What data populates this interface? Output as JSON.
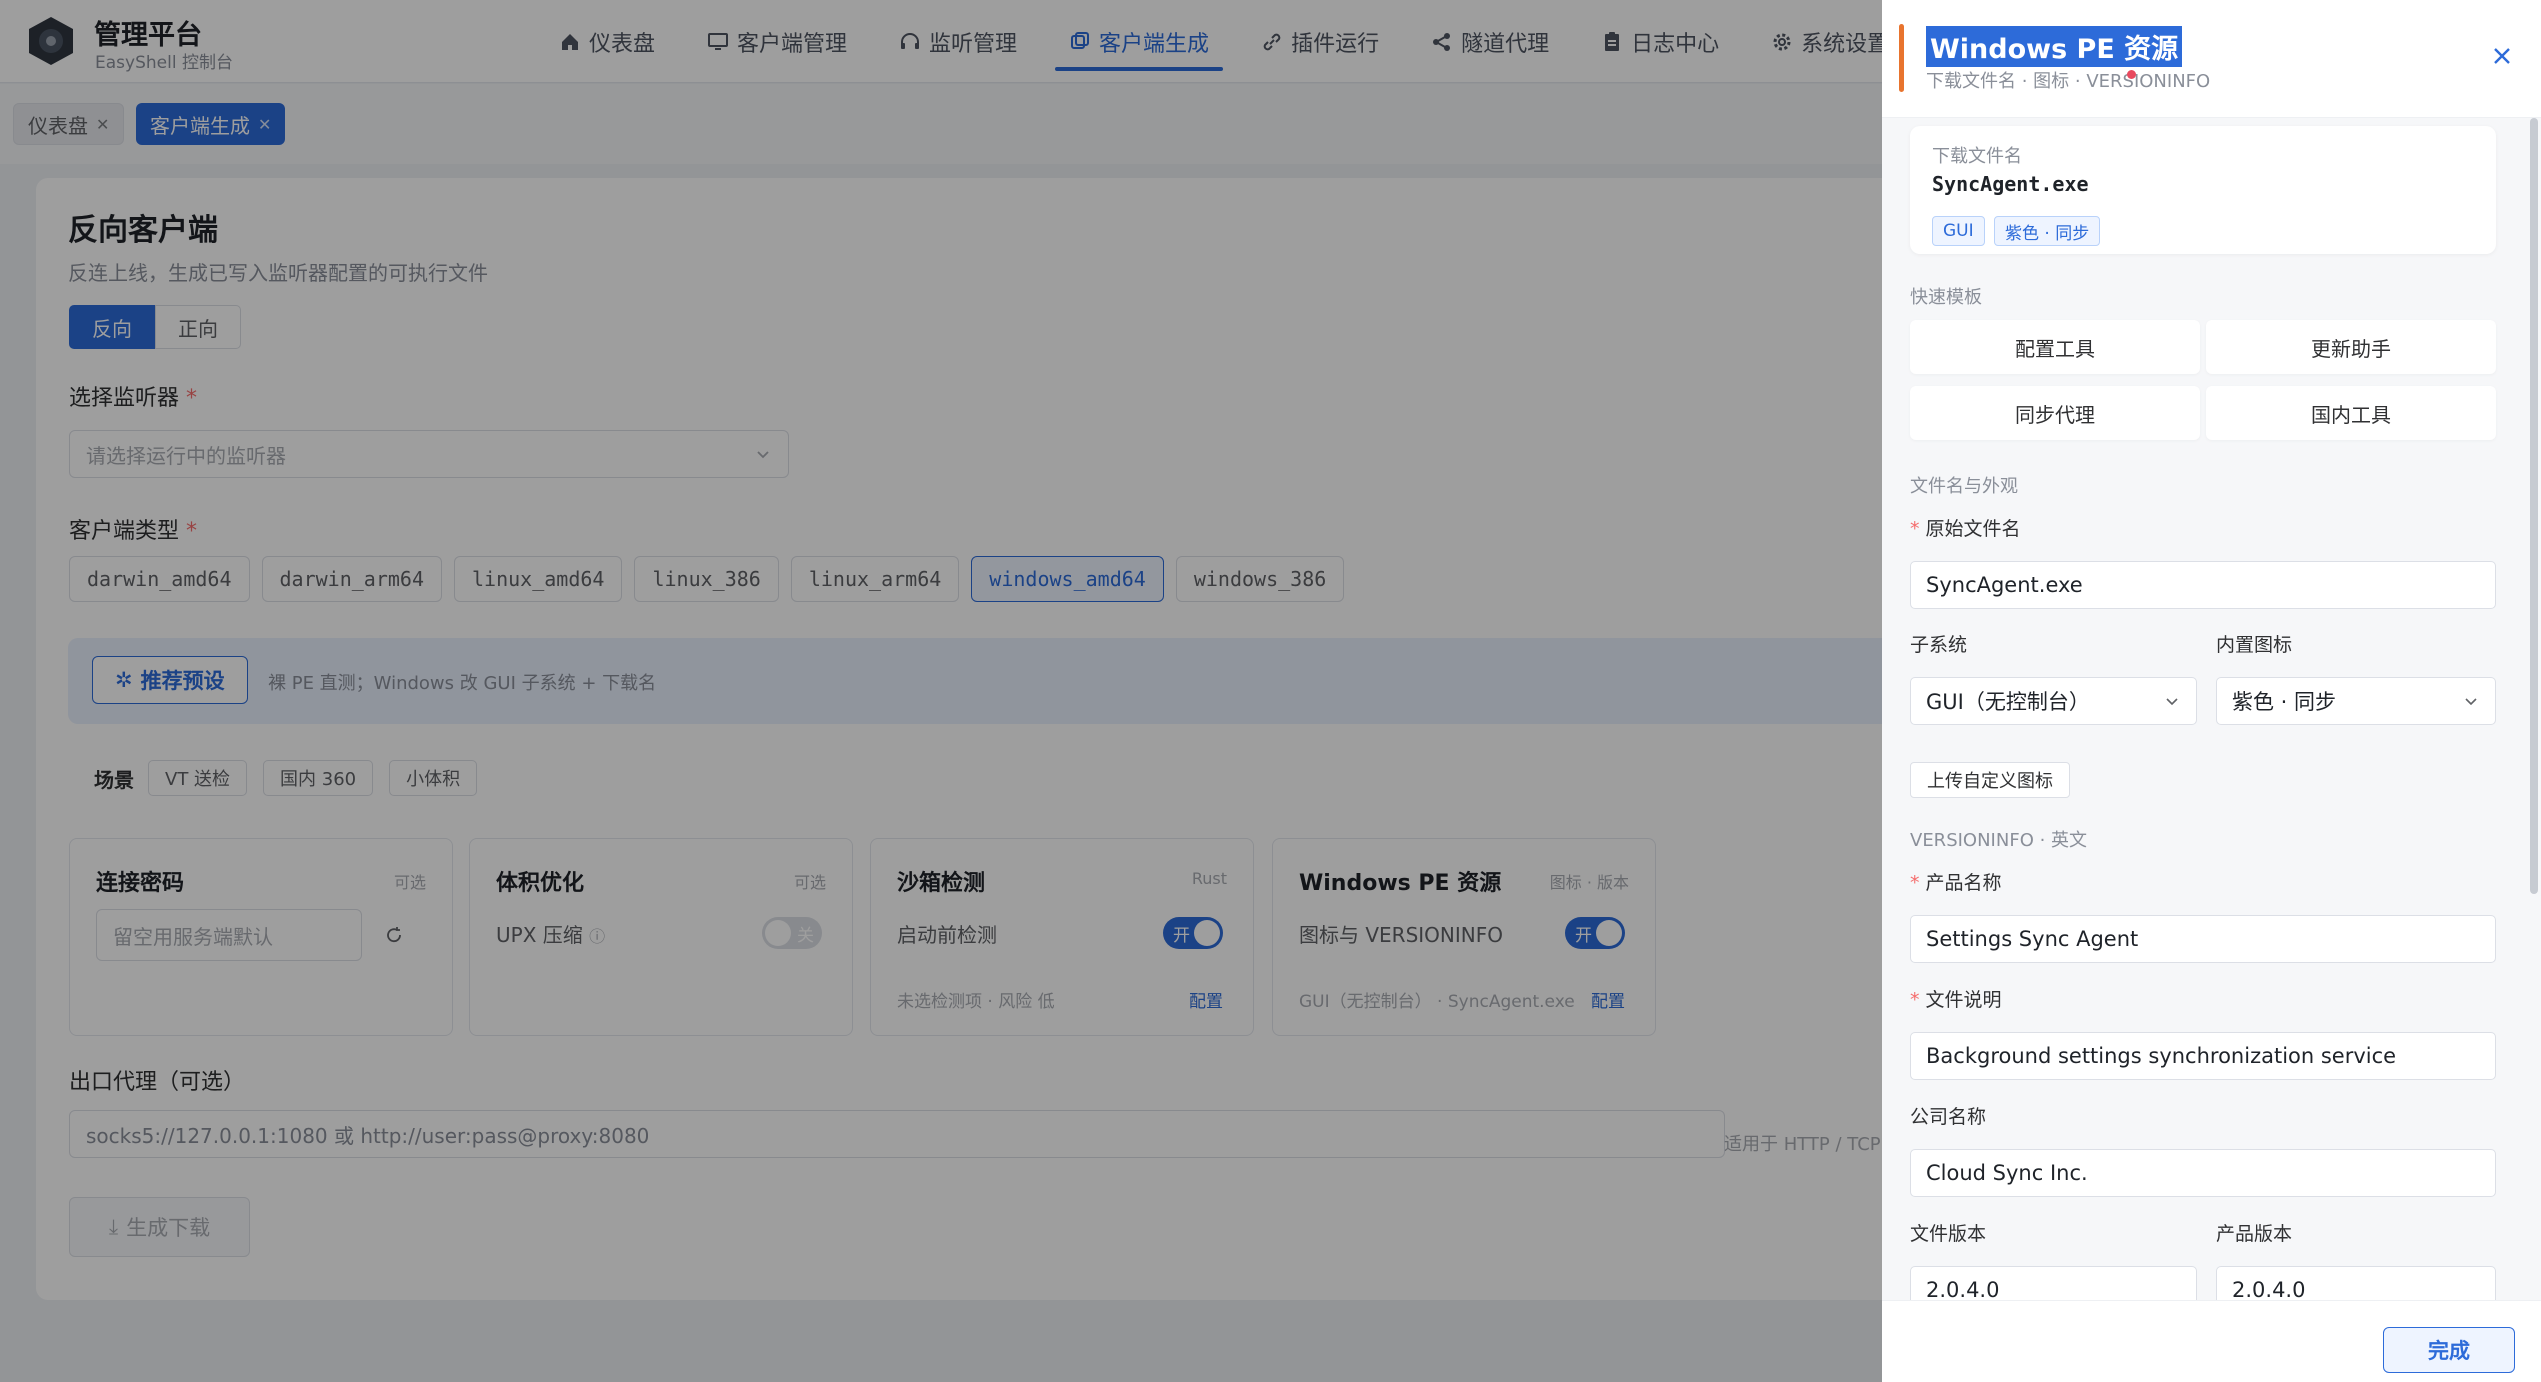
{
  "app": {
    "title": "管理平台",
    "subtitle": "EasyShell 控制台"
  },
  "nav": [
    {
      "label": "仪表盘",
      "icon": "home-icon"
    },
    {
      "label": "客户端管理",
      "icon": "monitor-icon"
    },
    {
      "label": "监听管理",
      "icon": "headset-icon"
    },
    {
      "label": "客户端生成",
      "icon": "generate-icon",
      "active": true
    },
    {
      "label": "插件运行",
      "icon": "link-icon"
    },
    {
      "label": "隧道代理",
      "icon": "share-icon"
    },
    {
      "label": "日志中心",
      "icon": "clipboard-icon"
    },
    {
      "label": "系统设置",
      "icon": "gear-icon"
    }
  ],
  "page_tabs": [
    {
      "label": "仪表盘",
      "active": false
    },
    {
      "label": "客户端生成",
      "active": true
    }
  ],
  "page": {
    "title": "反向客户端",
    "subtitle": "反连上线，生成已写入监听器配置的可执行文件",
    "mode": {
      "reverse": "反向",
      "forward": "正向"
    },
    "listener_label": "选择监听器",
    "listener_placeholder": "请选择运行中的监听器",
    "client_type_label": "客户端类型",
    "client_types": [
      "darwin_amd64",
      "darwin_arm64",
      "linux_amd64",
      "linux_386",
      "linux_arm64",
      "windows_amd64",
      "windows_386"
    ],
    "selected_type": "windows_amd64",
    "preset_button": "推荐预设",
    "preset_desc": "裸 PE 直测；Windows 改 GUI 子系统 + 下载名",
    "scene_label": "场景",
    "scenes": [
      "VT 送检",
      "国内 360",
      "小体积"
    ],
    "cards": {
      "password": {
        "title": "连接密码",
        "tag": "可选",
        "placeholder": "留空用服务端默认"
      },
      "size": {
        "title": "体积优化",
        "tag": "可选",
        "row": "UPX 压缩",
        "toggle": "关"
      },
      "sandbox": {
        "title": "沙箱检测",
        "tag": "Rust",
        "row": "启动前检测",
        "toggle": "开",
        "foot": "未选检测项 · 风险 低",
        "config": "配置"
      },
      "pe": {
        "title": "Windows PE 资源",
        "tag": "图标 · 版本",
        "row": "图标与 VERSIONINFO",
        "toggle": "开",
        "foot": "GUI（无控制台） · SyncAgent.exe",
        "config": "配置"
      }
    },
    "proxy_label": "出口代理（可选）",
    "proxy_placeholder": "socks5://127.0.0.1:1080 或 http://user:pass@proxy:8080",
    "proxy_hint": "适用于 HTTP / TCP",
    "generate_button": "生成下载"
  },
  "drawer": {
    "title": "Windows PE 资源",
    "subtitle": "下载文件名 · 图标 · VERSIONINFO",
    "summary": {
      "label": "下载文件名",
      "filename": "SyncAgent.exe",
      "tags": [
        "GUI",
        "紫色 · 同步"
      ]
    },
    "templates_label": "快速模板",
    "templates": [
      "配置工具",
      "更新助手",
      "同步代理",
      "国内工具"
    ],
    "filename_section": "文件名与外观",
    "orig_name_label": "原始文件名",
    "orig_name_value": "SyncAgent.exe",
    "subsystem_label": "子系统",
    "subsystem_value": "GUI（无控制台）",
    "icon_label": "内置图标",
    "icon_value": "紫色 · 同步",
    "upload_button": "上传自定义图标",
    "versioninfo_section": "VERSIONINFO · 英文",
    "product_name_label": "产品名称",
    "product_name_value": "Settings Sync Agent",
    "file_desc_label": "文件说明",
    "file_desc_value": "Background settings synchronization service",
    "company_label": "公司名称",
    "company_value": "Cloud Sync Inc.",
    "file_version_label": "文件版本",
    "file_version_value": "2.0.4.0",
    "product_version_label": "产品版本",
    "product_version_value": "2.0.4.0",
    "done_button": "完成"
  },
  "colors": {
    "accent": "#2d6bd9",
    "drawer_marker": "#e8742e",
    "required": "#f56c6c"
  }
}
